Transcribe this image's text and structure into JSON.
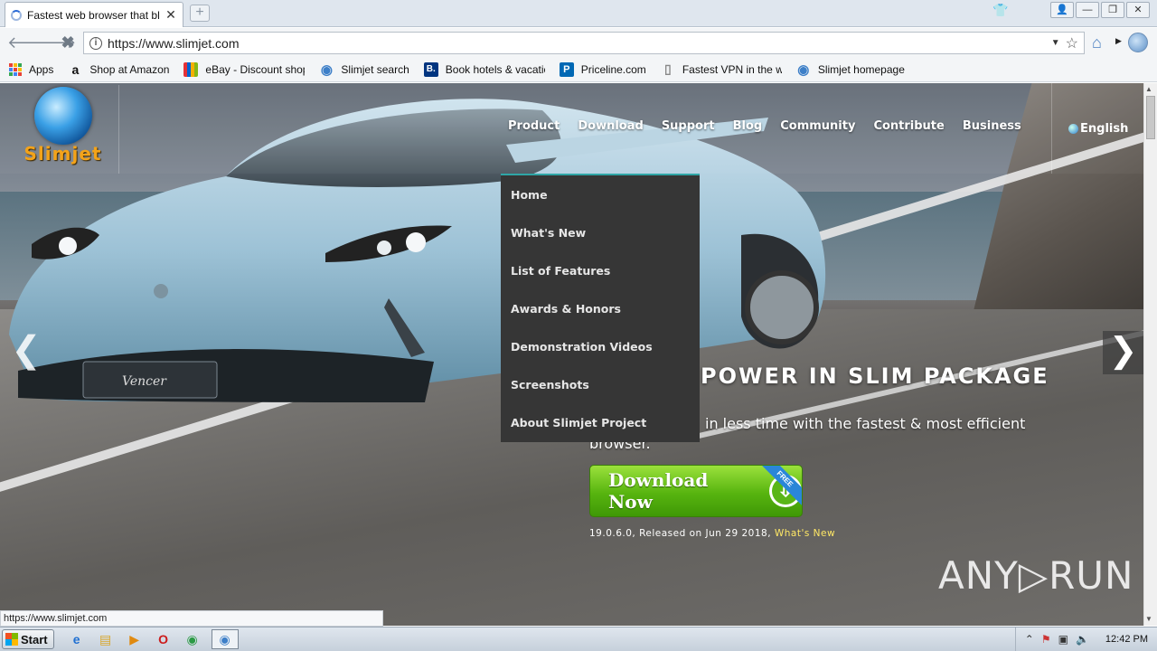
{
  "browser": {
    "tab_title": "Fastest web browser that bl",
    "tab_close": "✕",
    "new_tab": "+",
    "window_buttons": [
      "👤",
      "—",
      "❐",
      "✕"
    ],
    "url": "https://www.slimjet.com",
    "nav_back": "🡐",
    "nav_forward": "🡒",
    "nav_stop": "✖",
    "info_glyph": "i",
    "star": "☆",
    "dropdown_glyph": "▼"
  },
  "bookmarks": [
    {
      "label": "Apps",
      "icon": "apps-grid-icon"
    },
    {
      "label": "Shop at Amazon",
      "icon": "amazon-icon",
      "glyph": "a",
      "color": "#111111"
    },
    {
      "label": "eBay - Discount shoppi",
      "icon": "ebay-icon",
      "glyph": "e",
      "color": "#e53238"
    },
    {
      "label": "Slimjet search",
      "icon": "globe-icon",
      "glyph": "◉",
      "color": "#3d7fc8"
    },
    {
      "label": "Book hotels & vacation",
      "icon": "booking-icon",
      "glyph": "B.",
      "color": "#003580"
    },
    {
      "label": "Priceline.com",
      "icon": "priceline-icon",
      "glyph": "P",
      "color": "#0068b4"
    },
    {
      "label": "Fastest VPN in the wor",
      "icon": "page-icon",
      "glyph": "▯",
      "color": "#999999"
    },
    {
      "label": "Slimjet homepage",
      "icon": "globe-icon",
      "glyph": "◉",
      "color": "#3d7fc8"
    }
  ],
  "site": {
    "logo_text": "Slimjet",
    "nav": [
      "Product",
      "Download",
      "Support",
      "Blog",
      "Community",
      "Contribute",
      "Business"
    ],
    "language": "English",
    "product_menu": [
      "Home",
      "What's New",
      "List of Features",
      "Awards & Honors",
      "Demonstration Videos",
      "Screenshots",
      "About Slimjet Project"
    ],
    "headline": "POWER IN SLIM PACKAGE",
    "subline_1": "in less time with the fastest & most efficient",
    "subline_2": "browser.",
    "download_button": "Download Now",
    "free_ribbon": "FREE",
    "release_text": "19.0.6.0, Released on Jun 29 2018, ",
    "release_link": "What's New",
    "arrow_prev": "❮",
    "arrow_next": "❯",
    "watermark": "ANY▷RUN"
  },
  "status_bar": "https://www.slimjet.com",
  "taskbar": {
    "start_label": "Start",
    "clock": "12:42 PM"
  },
  "colors": {
    "logo_orange": "#f3a31a",
    "menu_bg": "#363636",
    "menu_accent": "#2fa6a6",
    "download_green": "#57b40f",
    "link_yellow": "#ffe866"
  }
}
